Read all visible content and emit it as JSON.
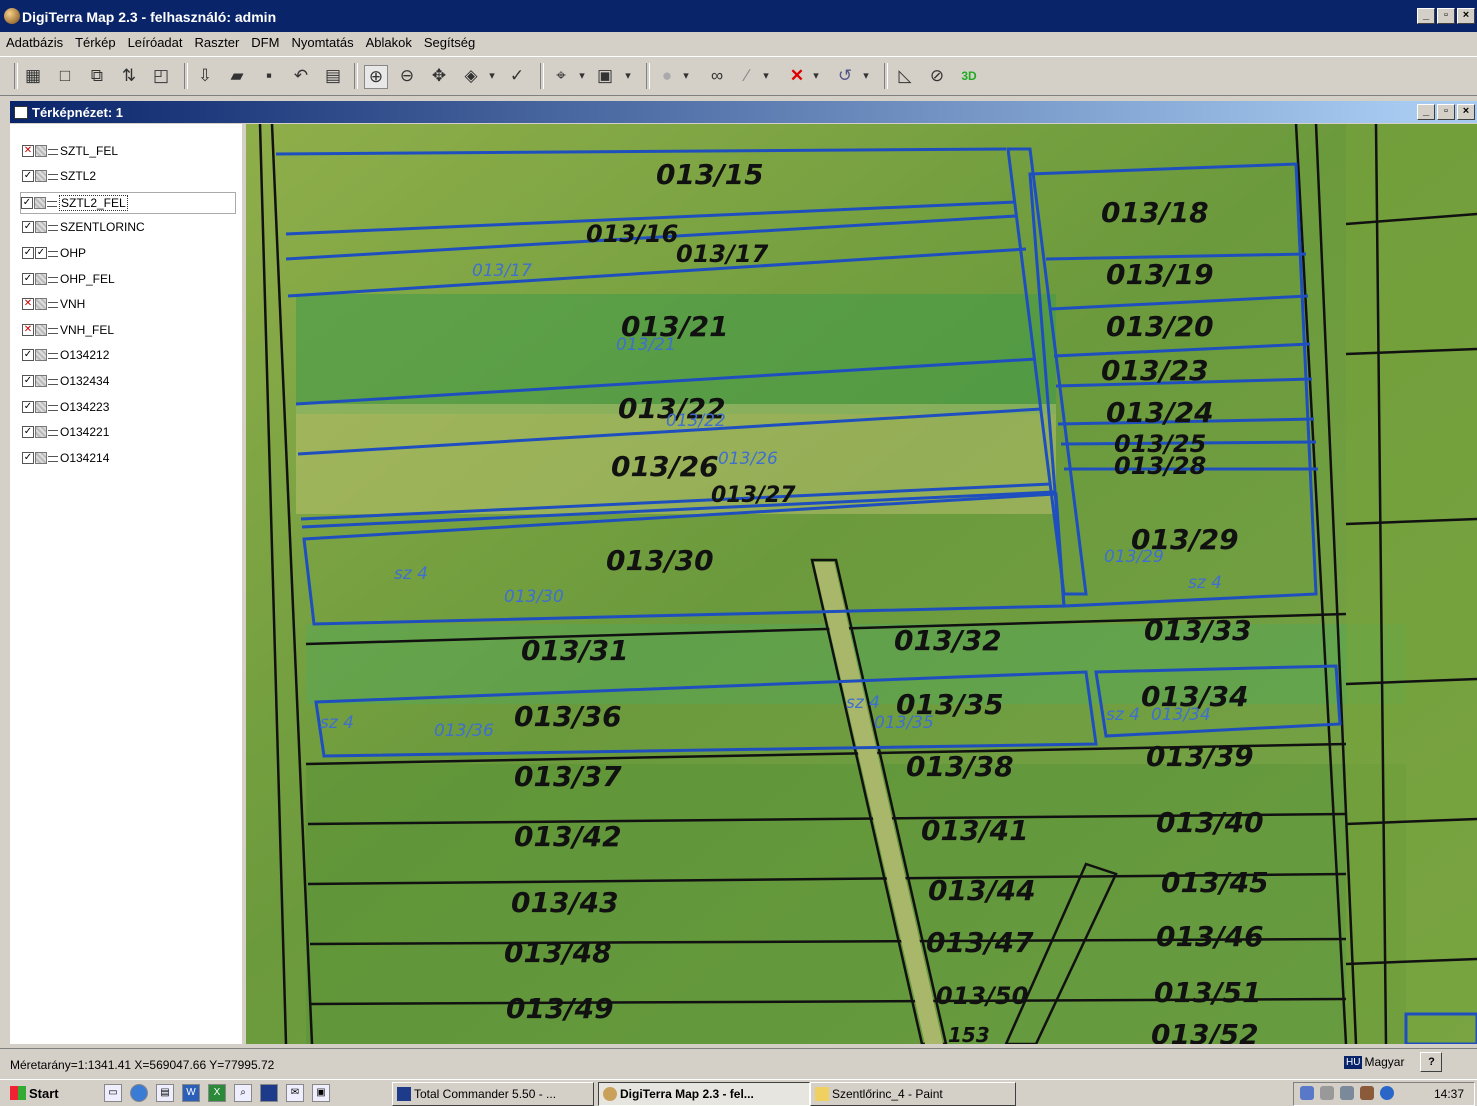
{
  "window": {
    "title": "DigiTerra Map 2.3 - felhasználó: admin",
    "min": "_",
    "max": "▫",
    "close": "×"
  },
  "menu": [
    "Adatbázis",
    "Térkép",
    "Leíróadat",
    "Raszter",
    "DFM",
    "Nyomtatás",
    "Ablakok",
    "Segítség"
  ],
  "mdi": {
    "title": "Térképnézet: 1"
  },
  "layers": [
    {
      "name": "SZTL_FEL",
      "checked": false
    },
    {
      "name": "SZTL2",
      "checked": true
    },
    {
      "name": "SZTL2_FEL",
      "checked": true,
      "selected": true
    },
    {
      "name": "SZENTLORINC",
      "checked": true
    },
    {
      "name": "OHP",
      "checked": true
    },
    {
      "name": "OHP_FEL",
      "checked": true
    },
    {
      "name": "VNH",
      "checked": false
    },
    {
      "name": "VNH_FEL",
      "checked": false
    },
    {
      "name": "O134212",
      "checked": true
    },
    {
      "name": "O132434",
      "checked": true
    },
    {
      "name": "O134223",
      "checked": true
    },
    {
      "name": "O134221",
      "checked": true
    },
    {
      "name": "O134214",
      "checked": true
    }
  ],
  "map_labels": [
    "013/15",
    "013/16",
    "013/17",
    "013/18",
    "013/19",
    "013/20",
    "013/21",
    "013/22",
    "013/23",
    "013/24",
    "013/25",
    "013/26",
    "013/27",
    "013/28",
    "013/29",
    "013/30",
    "013/31",
    "013/32",
    "013/33",
    "013/34",
    "013/35",
    "013/36",
    "013/37",
    "013/38",
    "013/39",
    "013/40",
    "013/41",
    "013/42",
    "013/43",
    "013/44",
    "013/45",
    "013/46",
    "013/47",
    "013/48",
    "013/49",
    "013/50",
    "013/51",
    "013/52",
    "153"
  ],
  "map_overlay_labels": [
    "sz 4",
    "013/30",
    "sz 4",
    "013/36",
    "sz 4",
    "013/35",
    "sz 4",
    "013/34",
    "013/17",
    "013/21",
    "013/22",
    "013/26",
    "013/29",
    "sz 4"
  ],
  "status": {
    "text": "Méretarány=1:1341.41  X=569047.66  Y=77995.72",
    "lang_code": "HU",
    "lang": "Magyar"
  },
  "taskbar": {
    "start": "Start",
    "tasks": [
      "Total Commander 5.50 - ...",
      "DigiTerra Map 2.3 - fel...",
      "Szentlőrinc_4 - Paint"
    ],
    "clock": "14:37"
  },
  "colors": {
    "title_bg": "#0a246a",
    "parcel_line": "#1f4fbf",
    "field_green": "#6f9a3a"
  }
}
